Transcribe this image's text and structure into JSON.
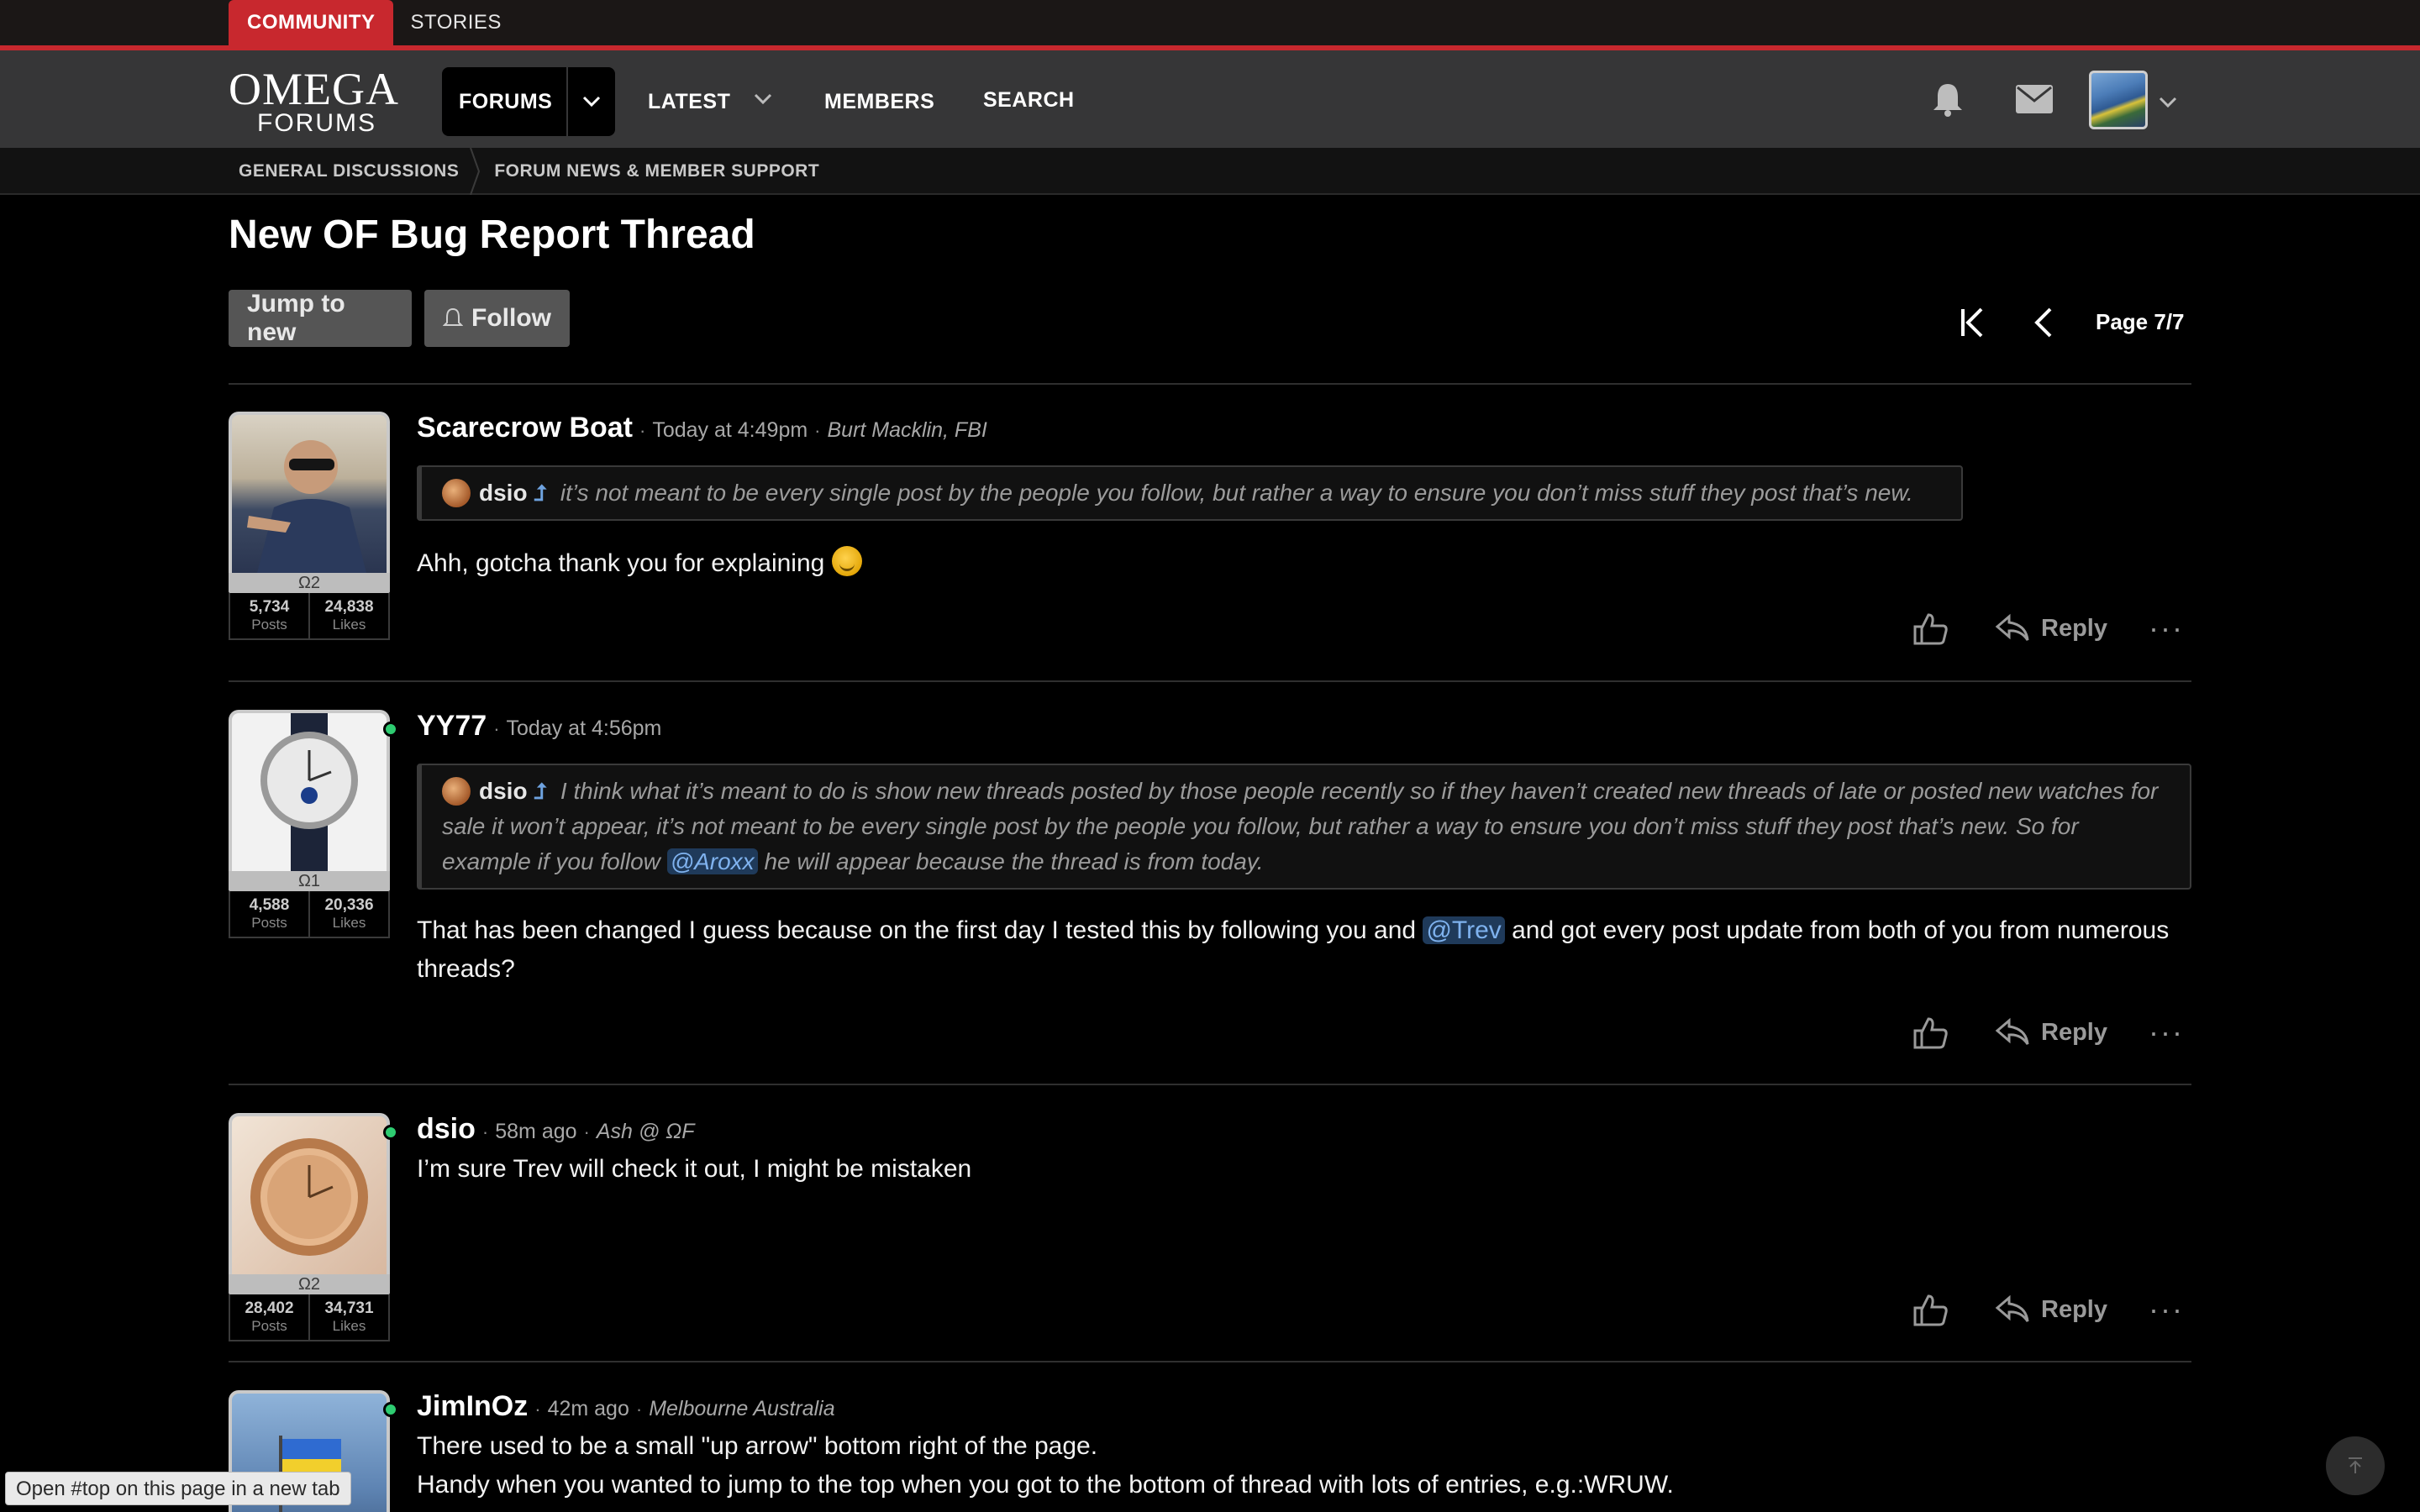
{
  "top_tabs": {
    "community": "COMMUNITY",
    "stories": "STORIES"
  },
  "logo": {
    "line1": "OMEGA",
    "line2": "FORUMS"
  },
  "nav": {
    "forums": "FORUMS",
    "latest": "LATEST",
    "members": "MEMBERS",
    "search": "SEARCH"
  },
  "breadcrumb": [
    "GENERAL DISCUSSIONS",
    "FORUM NEWS & MEMBER SUPPORT"
  ],
  "thread": {
    "title": "New OF Bug Report Thread",
    "jump_label": "Jump to new",
    "follow_label": "Follow",
    "page_label": "Page 7/7"
  },
  "reply_label": "Reply",
  "posts": [
    {
      "username": "Scarecrow Boat",
      "time": "Today at 4:49pm",
      "user_title": "Burt Macklin, FBI",
      "rank": "Ω2",
      "posts_count": "5,734",
      "likes_count": "24,838",
      "posts_word": "Posts",
      "likes_word": "Likes",
      "quote_author": "dsio",
      "quote_text": "it’s not meant to be every single post by the people you follow, but rather a way to ensure you don’t miss stuff they post that’s new.",
      "body": "Ahh, gotcha thank you for explaining"
    },
    {
      "username": "YY77",
      "time": "Today at 4:56pm",
      "rank": "Ω1",
      "posts_count": "4,588",
      "likes_count": "20,336",
      "posts_word": "Posts",
      "likes_word": "Likes",
      "quote_author": "dsio",
      "quote_text_1": "I think what it’s meant to do is show new threads posted by those people recently so if they haven’t created new threads of late or posted new watches for sale it won’t appear, it’s not meant to be every single post by the people you follow, but rather a way to ensure you don’t miss stuff they post that’s new. So for example if you follow ",
      "quote_mention": "@Aroxx",
      "quote_text_2": " he will appear because the thread is from today.",
      "body_1": "That has been changed I guess because on the first day I tested this by following you and ",
      "body_mention": "@Trev",
      "body_2": " and got every post update from both of you from numerous threads?"
    },
    {
      "username": "dsio",
      "time": "58m ago",
      "user_title": "Ash @ ΩF",
      "rank": "Ω2",
      "posts_count": "28,402",
      "likes_count": "34,731",
      "posts_word": "Posts",
      "likes_word": "Likes",
      "body": "I’m sure Trev will check it out, I might be mistaken"
    },
    {
      "username": "JimInOz",
      "time": "42m ago",
      "user_title": "Melbourne Australia",
      "body_1": "There used to be a small \"up arrow\" bottom right of the page.",
      "body_2": "Handy when you wanted to jump to the top when you got to the bottom of thread with lots of entries, e.g.:WRUW."
    }
  ],
  "status_tooltip": "Open #top on this page in a new tab",
  "colors": {
    "accent_red": "#c8282e",
    "navbar": "#363637",
    "mention_bg": "#1f3a5a",
    "mention_fg": "#7fb2ee",
    "online": "#2ecc71"
  }
}
